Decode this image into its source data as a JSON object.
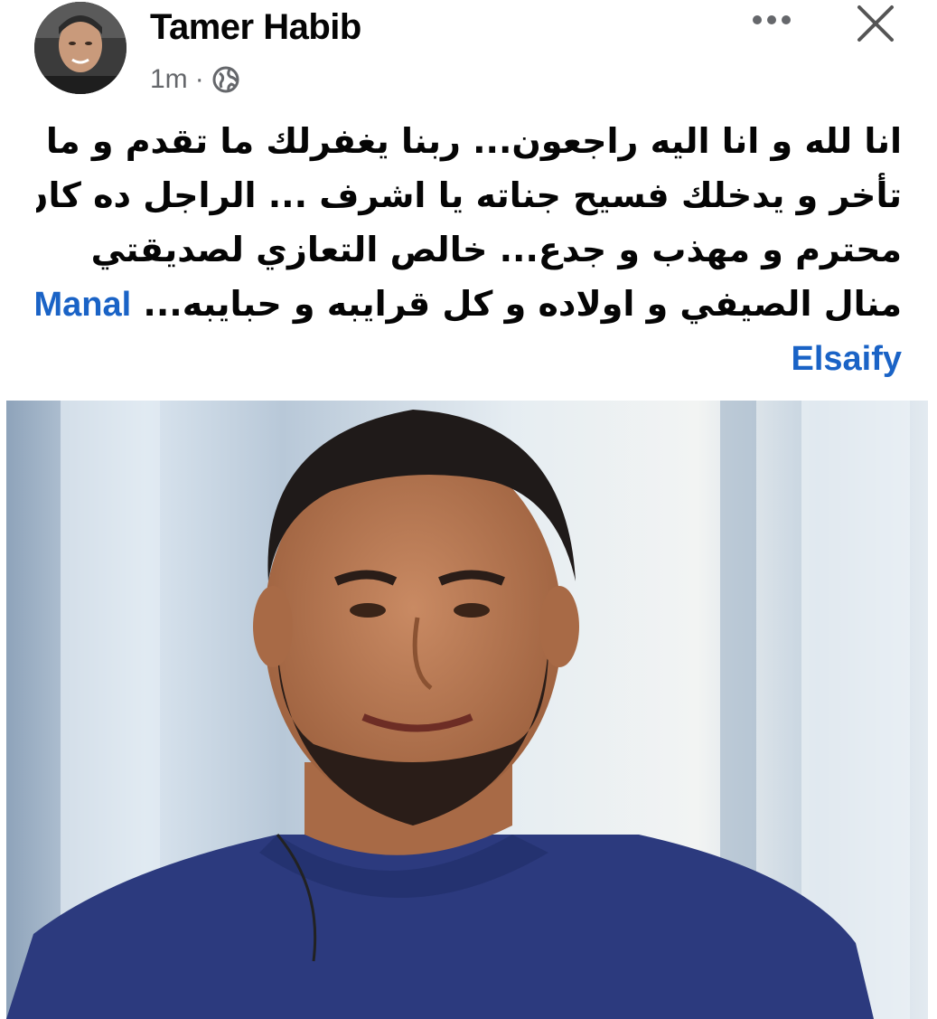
{
  "post": {
    "author": "Tamer Habib",
    "time": "1m",
    "separator": "·",
    "audience_icon": "globe-icon",
    "text_lines": [
      "انا لله و انا اليه راجعون... ربنا يغفرلك ما تقدم و ما",
      "تأخر و يدخلك فسيح جناته يا اشرف ... الراجل ده كان",
      "محترم و مهذب و جدع... خالص التعازي لصديقتي",
      "منال  الصيفي و اولاده و كل قرايبه و حبايبه..."
    ],
    "mention_line4": "Manal",
    "mention_line5": "Elsaify",
    "more_icon": "more-horizontal-icon",
    "close_icon": "close-icon"
  },
  "colors": {
    "text": "#050505",
    "meta": "#65676b",
    "mention": "#1a63c6",
    "shirt": "#2c3a7e"
  }
}
